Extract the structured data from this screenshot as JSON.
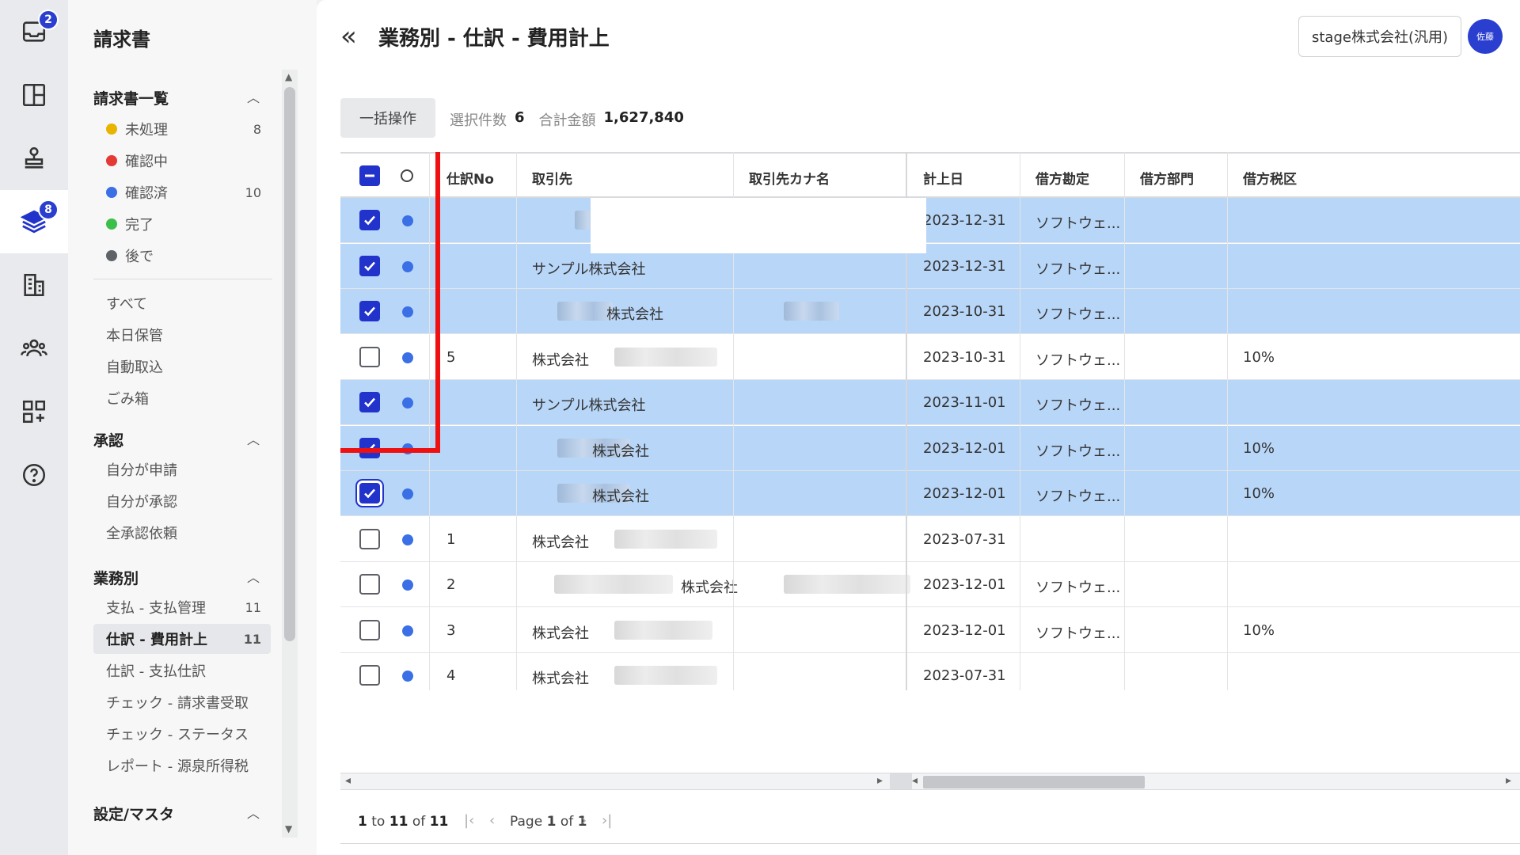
{
  "rail": {
    "inbox_badge": "2",
    "layers_badge": "8"
  },
  "sidebar": {
    "title": "請求書",
    "sections": {
      "list": "請求書一覧",
      "approval": "承認",
      "business": "業務別",
      "settings": "設定/マスタ"
    },
    "status_items": [
      {
        "label": "未処理",
        "count": "8",
        "color": "#e8b400"
      },
      {
        "label": "確認中",
        "count": "",
        "color": "#e53935"
      },
      {
        "label": "確認済",
        "count": "10",
        "color": "#3a6fe6"
      },
      {
        "label": "完了",
        "count": "",
        "color": "#3bbf4a"
      },
      {
        "label": "後で",
        "count": "",
        "color": "#5f6368"
      }
    ],
    "list_items": [
      "すべて",
      "本日保管",
      "自動取込",
      "ごみ箱"
    ],
    "approval_items": [
      "自分が申請",
      "自分が承認",
      "全承認依頼"
    ],
    "business_items": [
      {
        "label": "支払 - 支払管理",
        "count": "11"
      },
      {
        "label": "仕訳 - 費用計上",
        "count": "11"
      },
      {
        "label": "仕訳 - 支払仕訳",
        "count": ""
      },
      {
        "label": "チェック - 請求書受取",
        "count": ""
      },
      {
        "label": "チェック - ステータス",
        "count": ""
      },
      {
        "label": "レポート - 源泉所得税",
        "count": ""
      }
    ]
  },
  "header": {
    "title": "業務別 - 仕訳 - 費用計上",
    "company": "stage株式会社(汎用)",
    "avatar": "佐藤"
  },
  "toolbar": {
    "bulk_label": "一括操作",
    "selected_label": "選択件数",
    "selected_value": "6",
    "total_label": "合計金額",
    "total_value": "1,627,840"
  },
  "table": {
    "columns": [
      "仕訳No",
      "取引先",
      "取引先カナ名",
      "計上日",
      "借方勘定",
      "借方部門",
      "借方税区"
    ],
    "rows": [
      {
        "checked": true,
        "no": "",
        "vendor": "",
        "date": "2023-12-31",
        "account": "ソフトウェ...",
        "tax": ""
      },
      {
        "checked": true,
        "no": "",
        "vendor": "サンプル株式会社",
        "date": "2023-12-31",
        "account": "ソフトウェ...",
        "tax": ""
      },
      {
        "checked": true,
        "no": "",
        "vendor": "株式会社",
        "date": "2023-10-31",
        "account": "ソフトウェ...",
        "tax": ""
      },
      {
        "checked": false,
        "no": "5",
        "vendor": "株式会社",
        "date": "2023-10-31",
        "account": "ソフトウェ...",
        "tax": "10%"
      },
      {
        "checked": true,
        "no": "",
        "vendor": "サンプル株式会社",
        "date": "2023-11-01",
        "account": "ソフトウェ...",
        "tax": ""
      },
      {
        "checked": true,
        "no": "",
        "vendor": "株式会社",
        "date": "2023-12-01",
        "account": "ソフトウェ...",
        "tax": "10%"
      },
      {
        "checked": true,
        "no": "",
        "vendor": "株式会社",
        "date": "2023-12-01",
        "account": "ソフトウェ...",
        "tax": "10%"
      },
      {
        "checked": false,
        "no": "1",
        "vendor": "株式会社",
        "date": "2023-07-31",
        "account": "",
        "tax": ""
      },
      {
        "checked": false,
        "no": "2",
        "vendor": "株式会社",
        "date": "2023-12-01",
        "account": "ソフトウェ...",
        "tax": ""
      },
      {
        "checked": false,
        "no": "3",
        "vendor": "株式会社",
        "date": "2023-12-01",
        "account": "ソフトウェ...",
        "tax": "10%"
      },
      {
        "checked": false,
        "no": "4",
        "vendor": "株式会社",
        "date": "2023-07-31",
        "account": "",
        "tax": ""
      }
    ]
  },
  "pager": {
    "range_from": "1",
    "range_to": "11",
    "range_total": "11",
    "to_word": "to",
    "of_word": "of",
    "page_word": "Page",
    "page_current": "1",
    "page_total": "1"
  },
  "colors": {
    "accent": "#2233cc",
    "selected_row": "#b8d6f8",
    "highlight_box": "#ee1111"
  }
}
